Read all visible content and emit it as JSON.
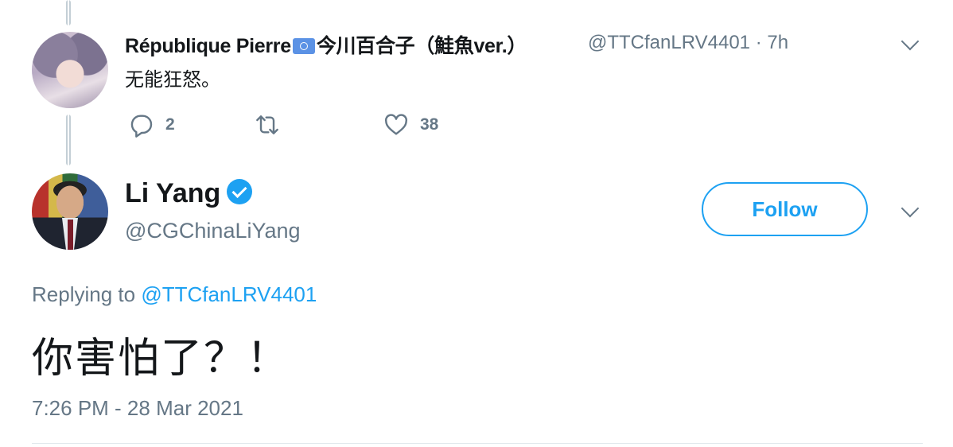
{
  "parent_tweet": {
    "display_name_prefix": "République Pierre",
    "display_name_suffix": "今川百合子（鮭魚ver.）",
    "handle": "@TTCfanLRV4401",
    "time": "· 7h",
    "text": "无能狂怒。",
    "reply_count": "2",
    "retweet_count": "",
    "like_count": "38"
  },
  "main_tweet": {
    "display_name": "Li Yang",
    "handle": "@CGChinaLiYang",
    "follow_label": "Follow",
    "replying_prefix": "Replying to ",
    "replying_handle": "@TTCfanLRV4401",
    "text": "你害怕了？！",
    "timestamp": "7:26 PM - 28 Mar 2021"
  },
  "colors": {
    "accent": "#1da1f2",
    "secondary_text": "#657786",
    "primary_text": "#14171a"
  },
  "icons": [
    "reply-icon",
    "retweet-icon",
    "like-icon",
    "verified-badge-icon",
    "un-flag-icon",
    "chevron-down-icon"
  ]
}
